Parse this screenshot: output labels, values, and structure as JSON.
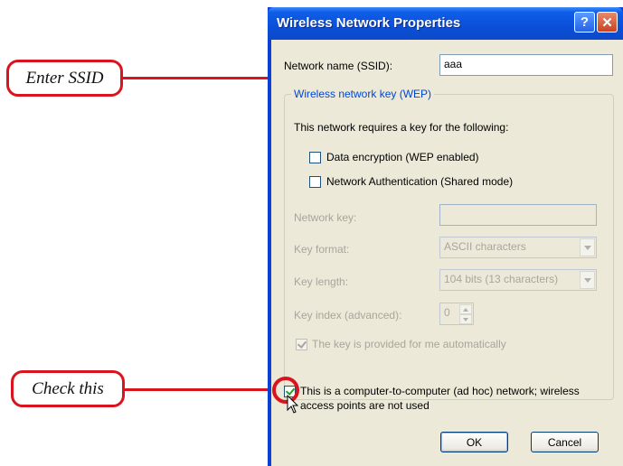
{
  "callouts": {
    "ssid": "Enter SSID",
    "check": "Check this"
  },
  "window": {
    "title": "Wireless Network Properties",
    "help_glyph": "?",
    "close_glyph": "✕"
  },
  "form": {
    "ssid_label": "Network name (SSID):",
    "ssid_value": "aaa",
    "group_caption": "Wireless network key (WEP)",
    "requires_text": "This network requires a key for the following:",
    "data_encryption_label": "Data encryption (WEP enabled)",
    "data_encryption_checked": false,
    "net_auth_label": "Network Authentication (Shared mode)",
    "net_auth_checked": false,
    "network_key_label": "Network key:",
    "network_key_value": "",
    "key_format_label": "Key format:",
    "key_format_value": "ASCII characters",
    "key_length_label": "Key length:",
    "key_length_value": "104 bits (13 characters)",
    "key_index_label": "Key index (advanced):",
    "key_index_value": "0",
    "auto_key_label": "The key is provided for me automatically",
    "auto_key_checked": true,
    "adhoc_label_line1": "This is a computer-to-computer (ad hoc) network; wireless",
    "adhoc_label_line2": "access points are not used",
    "adhoc_checked": true
  },
  "buttons": {
    "ok": "OK",
    "cancel": "Cancel"
  },
  "colors": {
    "callout_red": "#d9141f",
    "titlebar_blue": "#0a4fd9",
    "dialog_bg": "#ece9d8",
    "group_caption_blue": "#0046d5"
  }
}
